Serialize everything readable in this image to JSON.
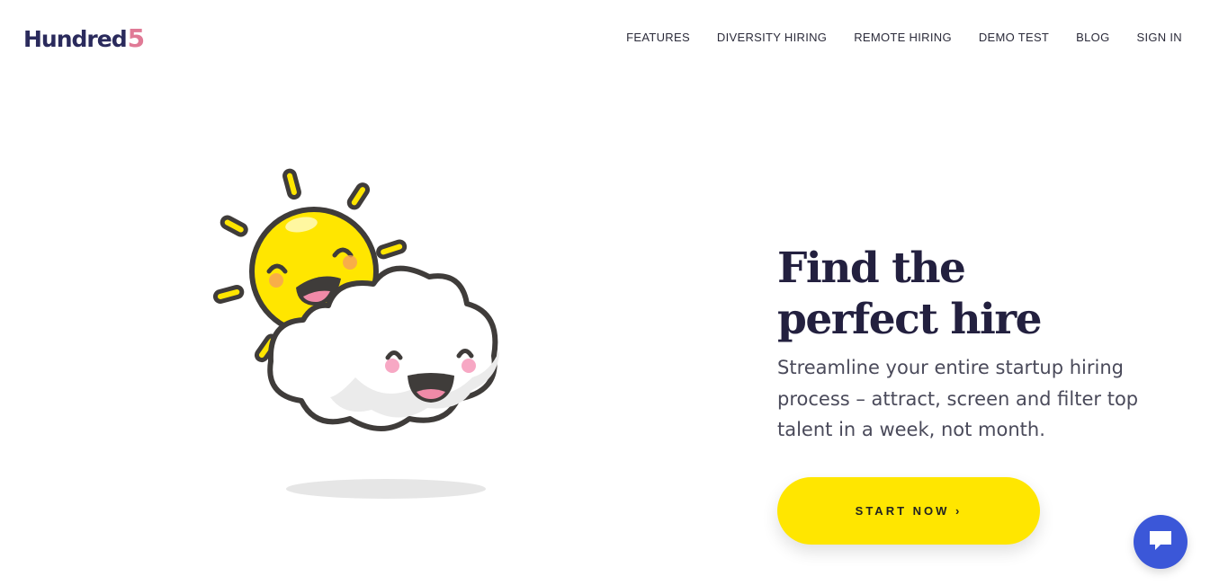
{
  "logo": {
    "text": "Hundred",
    "accent": "5"
  },
  "nav": {
    "items": [
      {
        "label": "FEATURES"
      },
      {
        "label": "DIVERSITY HIRING"
      },
      {
        "label": "REMOTE HIRING"
      },
      {
        "label": "DEMO TEST"
      },
      {
        "label": "BLOG"
      },
      {
        "label": "SIGN IN"
      }
    ]
  },
  "hero": {
    "title_line1": "Find the",
    "title_line2": "perfect hire",
    "subtitle": "Streamline your entire startup hiring process – attract, screen and filter top talent in a week, not month.",
    "cta_label": "START NOW ›"
  },
  "illustration": {
    "icon": "sun-and-cloud-illustration"
  },
  "chat": {
    "icon": "chat-bubble-icon"
  },
  "colors": {
    "brand_dark": "#23203f",
    "brand_pink": "#e07a96",
    "cta_yellow": "#ffe600",
    "chat_blue": "#3b57d8"
  }
}
